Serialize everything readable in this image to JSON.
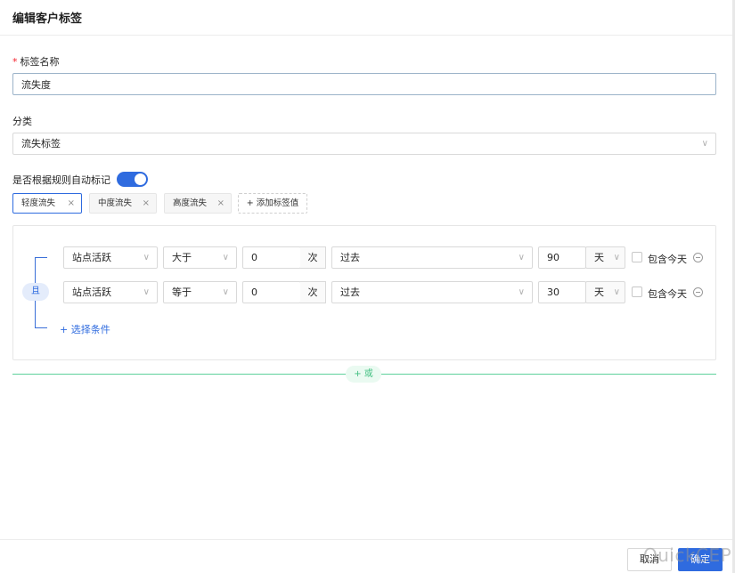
{
  "header": {
    "title": "编辑客户标签"
  },
  "form": {
    "name": {
      "required_mark": "*",
      "label": "标签名称",
      "value": "流失度"
    },
    "category": {
      "label": "分类",
      "value": "流失标签"
    },
    "auto_tag": {
      "label": "是否根据规则自动标记",
      "enabled": true
    }
  },
  "tag_values": [
    {
      "label": "轻度流失",
      "active": true
    },
    {
      "label": "中度流失",
      "active": false
    },
    {
      "label": "高度流失",
      "active": false
    }
  ],
  "add_tag_label": "+ 添加标签值",
  "rules": {
    "logic": "且",
    "conditions": [
      {
        "metric": "站点活跃",
        "operator": "大于",
        "count": "0",
        "count_unit": "次",
        "period": "过去",
        "days": "90",
        "days_unit": "天",
        "include_today": "包含今天",
        "include_today_checked": false
      },
      {
        "metric": "站点活跃",
        "operator": "等于",
        "count": "0",
        "count_unit": "次",
        "period": "过去",
        "days": "30",
        "days_unit": "天",
        "include_today": "包含今天",
        "include_today_checked": false
      }
    ],
    "add_condition": "+ 选择条件"
  },
  "or_label": "+ 或",
  "footer": {
    "cancel": "取消",
    "ok": "确定"
  },
  "watermark": "QuickCEP",
  "icons": {
    "dropdown": "chevron-down-icon",
    "close": "close-icon",
    "remove": "minus-circle-icon"
  },
  "colors": {
    "primary": "#2f6bdf",
    "or_accent": "#3fbf7f",
    "required": "#f5222d"
  }
}
